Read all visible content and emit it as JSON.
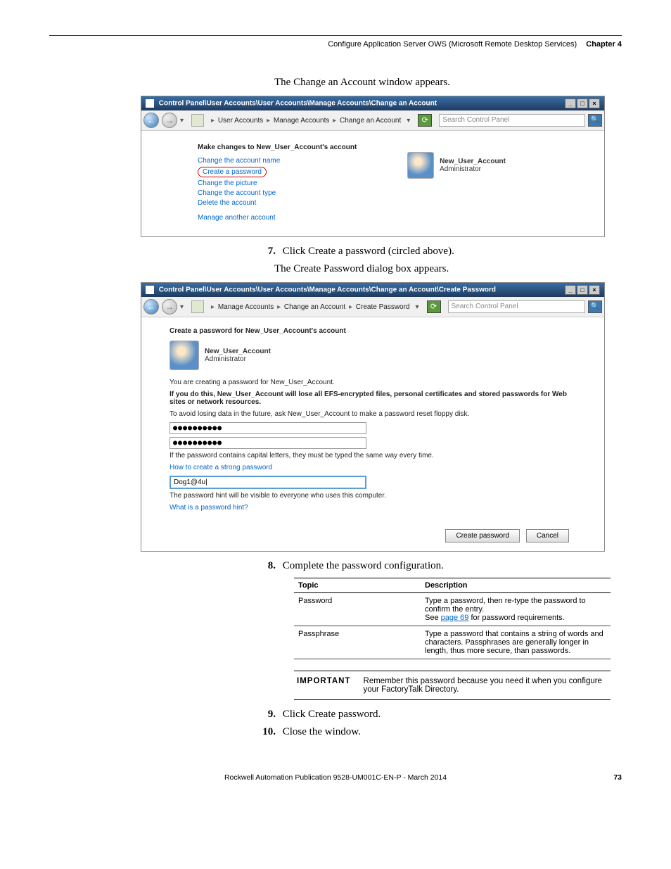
{
  "header": {
    "text": "Configure Application Server OWS (Microsoft Remote Desktop Services)",
    "chapter": "Chapter 4"
  },
  "body": {
    "line1": "The Change an Account window appears.",
    "step7_num": "7.",
    "step7_text": "Click Create a password (circled above).",
    "line2": "The Create Password dialog box appears.",
    "step8_num": "8.",
    "step8_text": "Complete the password configuration.",
    "step9_num": "9.",
    "step9_text": "Click Create password.",
    "step10_num": "10.",
    "step10_text": "Close the window."
  },
  "dialog1": {
    "title": "Control Panel\\User Accounts\\User Accounts\\Manage Accounts\\Change an Account",
    "bc1": "User Accounts",
    "bc2": "Manage Accounts",
    "bc3": "Change an Account",
    "search_placeholder": "Search Control Panel",
    "heading": "Make changes to New_User_Account's account",
    "link1": "Change the account name",
    "link2": "Create a password",
    "link3": "Change the picture",
    "link4": "Change the account type",
    "link5": "Delete the account",
    "link6": "Manage another account",
    "username": "New_User_Account",
    "role": "Administrator"
  },
  "dialog2": {
    "title": "Control Panel\\User Accounts\\User Accounts\\Manage Accounts\\Change an Account\\Create Password",
    "bc1": "Manage Accounts",
    "bc2": "Change an Account",
    "bc3": "Create Password",
    "search_placeholder": "Search Control Panel",
    "heading": "Create a password for New_User_Account's account",
    "username": "New_User_Account",
    "role": "Administrator",
    "txt1": "You are creating a password for New_User_Account.",
    "txt2": "If you do this, New_User_Account will lose all EFS-encrypted files, personal certificates and stored passwords for Web sites or network resources.",
    "txt3": "To avoid losing data in the future, ask New_User_Account to make a password reset floppy disk.",
    "pw1": "●●●●●●●●●●",
    "pw2": "●●●●●●●●●●",
    "txt4": "If the password contains capital letters, they must be typed the same way every time.",
    "link_strong": "How to create a strong password",
    "hint": "Dog1@4u|",
    "txt5": "The password hint will be visible to everyone who uses this computer.",
    "link_hint": "What is a password hint?",
    "btn_create": "Create password",
    "btn_cancel": "Cancel"
  },
  "table": {
    "h1": "Topic",
    "h2": "Description",
    "r1c1": "Password",
    "r1c2a": "Type a password, then re-type the password to confirm the entry.",
    "r1c2b_pre": "See ",
    "r1c2b_link": "page 69",
    "r1c2b_post": " for password requirements.",
    "r2c1": "Passphrase",
    "r2c2": "Type a password that contains a string of words and characters. Passphrases are generally longer in length, thus more secure, than passwords."
  },
  "important": {
    "label": "IMPORTANT",
    "text": "Remember this password because you need it when you configure your FactoryTalk Directory."
  },
  "footer": {
    "text": "Rockwell Automation Publication 9528-UM001C-EN-P - March 2014",
    "page": "73"
  }
}
